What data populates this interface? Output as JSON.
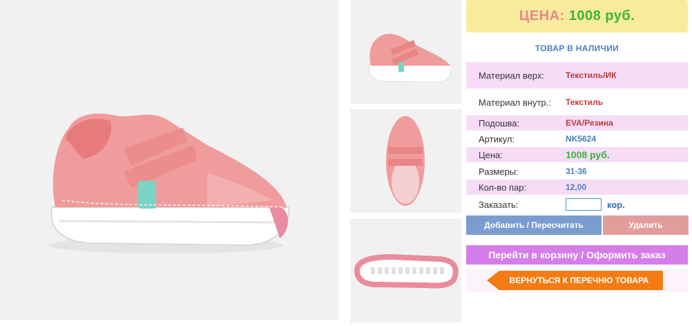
{
  "price_banner": {
    "label": "ЦЕНА:",
    "value": "1008 руб."
  },
  "stock_status": "ТОВАР В НАЛИЧИИ",
  "specs": [
    {
      "label": "Материал верх:",
      "value": "Текстиль/ИК"
    },
    {
      "label": "Материал внутр.:",
      "value": "Текстиль"
    },
    {
      "label": "Подошва:",
      "value": "EVA/Резина"
    },
    {
      "label": "Артикул:",
      "value": "NK5624"
    },
    {
      "label": "Цена:",
      "value": "1008 руб."
    },
    {
      "label": "Размеры:",
      "value": "31-36"
    },
    {
      "label": "Кол-во пар:",
      "value": "12,00"
    }
  ],
  "order": {
    "label": "Заказать:",
    "value": "",
    "unit": "кор."
  },
  "buttons": {
    "add": "Добавить / Пересчитать",
    "delete": "Удалить",
    "cart": "Перейти в корзину / Оформить заказ",
    "back": "ВЕРНУТЬСЯ К ПЕРЕЧНЮ ТОВАРА"
  },
  "colors": {
    "accent_pink": "#f6dcf7",
    "shoe": "#f08a8a",
    "green_price": "#3eb43c",
    "blue": "#4a7fc0"
  }
}
